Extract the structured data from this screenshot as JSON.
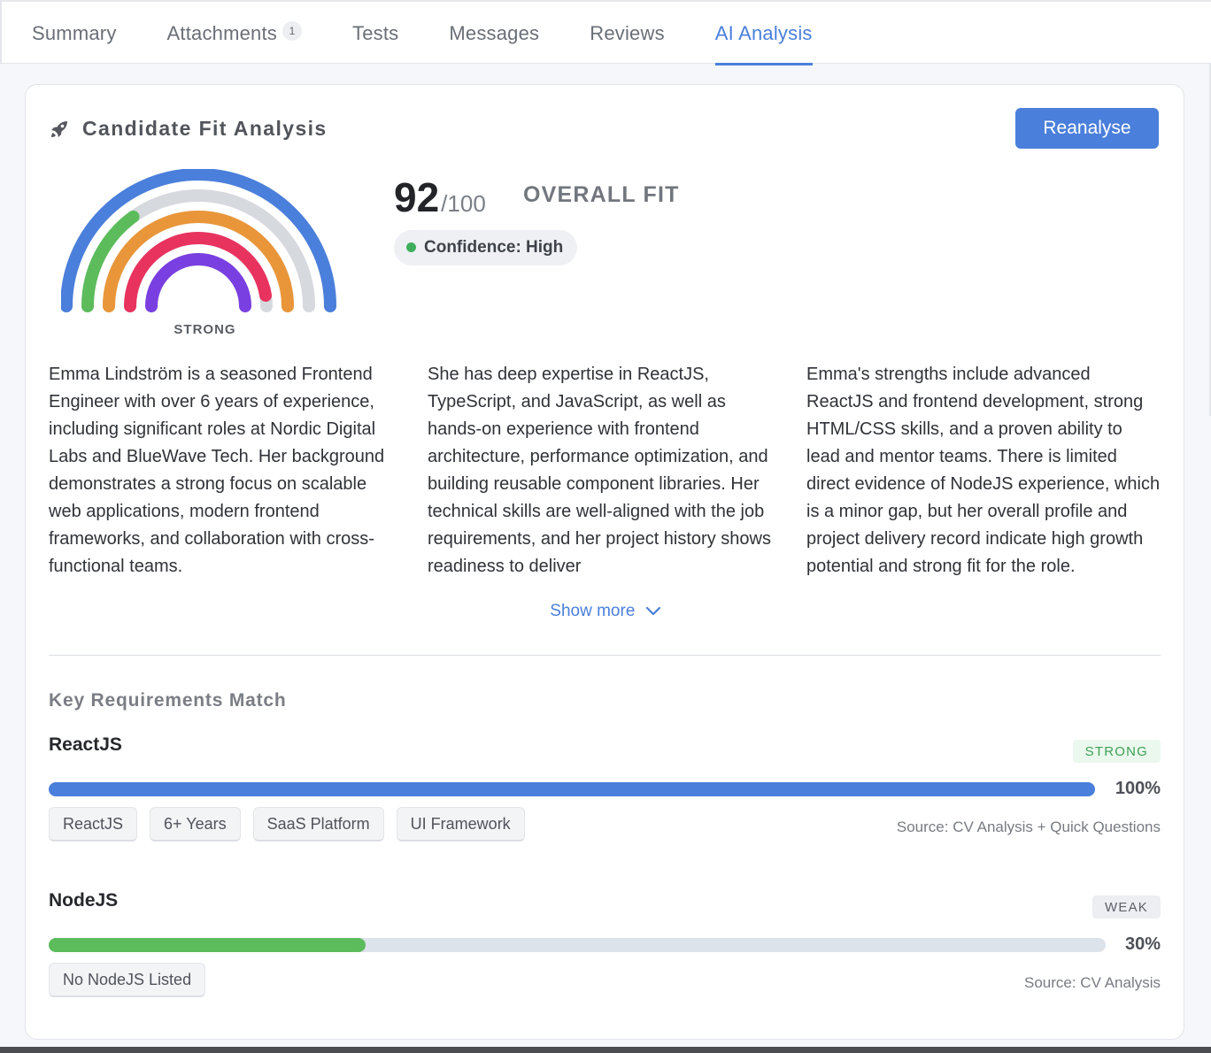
{
  "tabs": [
    {
      "label": "Summary"
    },
    {
      "label": "Attachments",
      "badge": "1"
    },
    {
      "label": "Tests"
    },
    {
      "label": "Messages"
    },
    {
      "label": "Reviews"
    },
    {
      "label": "AI Analysis",
      "active": true
    }
  ],
  "card": {
    "title": "Candidate Fit Analysis",
    "title_icon": "rocket-icon",
    "reanalyse_label": "Reanalyse"
  },
  "gauge": {
    "label": "STRONG",
    "arcs": [
      {
        "color": "#4a7fdb",
        "fill": 1.0
      },
      {
        "color": "#5cbc5c",
        "fill": 0.3
      },
      {
        "color": "#e9963a",
        "fill": 1.0
      },
      {
        "color": "#e8335f",
        "fill": 0.95
      },
      {
        "color": "#7a3fe0",
        "fill": 1.0
      }
    ],
    "track_color": "#d6d9de"
  },
  "score": {
    "value": "92",
    "denominator": "/100",
    "label": "OVERALL FIT",
    "confidence": "Confidence: High"
  },
  "summary": {
    "col1": "Emma Lindström is a seasoned Frontend Engineer with over 6 years of experience, including significant roles at Nordic Digital Labs and BlueWave Tech. Her background demonstrates a strong focus on scalable web applications, modern frontend frameworks, and collaboration with cross-functional teams.",
    "col2": "She has deep expertise in ReactJS, TypeScript, and JavaScript, as well as hands-on experience with frontend architecture, performance optimization, and building reusable component libraries. Her technical skills are well-aligned with the job requirements, and her project history shows readiness to deliver",
    "col3": "Emma's strengths include advanced ReactJS and frontend development, strong HTML/CSS skills, and a proven ability to lead and mentor teams. There is limited direct evidence of NodeJS experience, which is a minor gap, but her overall profile and project delivery record indicate high growth potential and strong fit for the role.",
    "show_more": "Show more"
  },
  "requirements": {
    "title": "Key Requirements Match",
    "items": [
      {
        "name": "ReactJS",
        "badge": "STRONG",
        "percent": 100,
        "percent_label": "100%",
        "bar_color": "#4a7fdb",
        "chips": [
          "ReactJS",
          "6+ Years",
          "SaaS Platform",
          "UI Framework"
        ],
        "source": "Source: CV Analysis + Quick Questions"
      },
      {
        "name": "NodeJS",
        "badge": "WEAK",
        "percent": 30,
        "percent_label": "30%",
        "bar_color": "#5cbc5c",
        "chips": [
          "No NodeJS Listed"
        ],
        "source": "Source: CV Analysis"
      }
    ]
  }
}
